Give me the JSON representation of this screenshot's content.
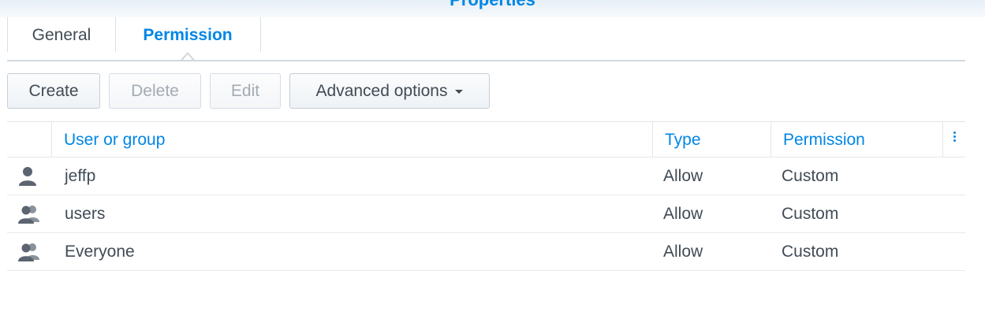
{
  "window": {
    "title": "Properties"
  },
  "tabs": [
    {
      "label": "General",
      "active": false
    },
    {
      "label": "Permission",
      "active": true
    }
  ],
  "toolbar": {
    "create_label": "Create",
    "delete_label": "Delete",
    "edit_label": "Edit",
    "advanced_label": "Advanced options"
  },
  "table": {
    "columns": [
      "User or group",
      "Type",
      "Permission"
    ],
    "rows": [
      {
        "icon": "user-icon",
        "name": "jeffp",
        "type": "Allow",
        "permission": "Custom"
      },
      {
        "icon": "group-icon",
        "name": "users",
        "type": "Allow",
        "permission": "Custom"
      },
      {
        "icon": "group-icon",
        "name": "Everyone",
        "type": "Allow",
        "permission": "Custom"
      }
    ]
  },
  "colors": {
    "accent": "#0086e5",
    "text": "#414b55",
    "disabled": "#a3abb3",
    "icon": "#5b6470"
  }
}
